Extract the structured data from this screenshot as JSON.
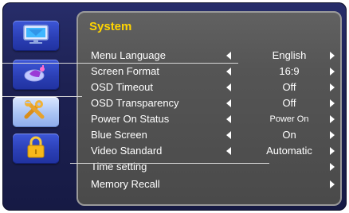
{
  "sidebar": {
    "items": [
      {
        "name": "picture-icon"
      },
      {
        "name": "sound-icon"
      },
      {
        "name": "tools-icon"
      },
      {
        "name": "lock-icon"
      }
    ]
  },
  "panel": {
    "title": "System",
    "rows": [
      {
        "label": "Menu Language",
        "value": "English",
        "left_arrow": true,
        "right_arrow": true
      },
      {
        "label": "Screen Format",
        "value": "16:9",
        "left_arrow": true,
        "right_arrow": true
      },
      {
        "label": "OSD Timeout",
        "value": "Off",
        "left_arrow": true,
        "right_arrow": true
      },
      {
        "label": "OSD Transparency",
        "value": "Off",
        "left_arrow": true,
        "right_arrow": true
      },
      {
        "label": "Power On Status",
        "value": "Power On",
        "left_arrow": true,
        "right_arrow": true
      },
      {
        "label": "Blue Screen",
        "value": "On",
        "left_arrow": true,
        "right_arrow": true
      },
      {
        "label": "Video Standard",
        "value": "Automatic",
        "left_arrow": true,
        "right_arrow": true
      },
      {
        "label": "Time setting",
        "value": "",
        "left_arrow": false,
        "right_arrow": true
      },
      {
        "label": "Memory Recall",
        "value": "",
        "left_arrow": false,
        "right_arrow": true
      }
    ]
  },
  "colors": {
    "title": "#ffd400",
    "background": "#1d2152",
    "panel": "#555555",
    "button": "#2b3fb5",
    "button_active": "#aac4f4"
  }
}
